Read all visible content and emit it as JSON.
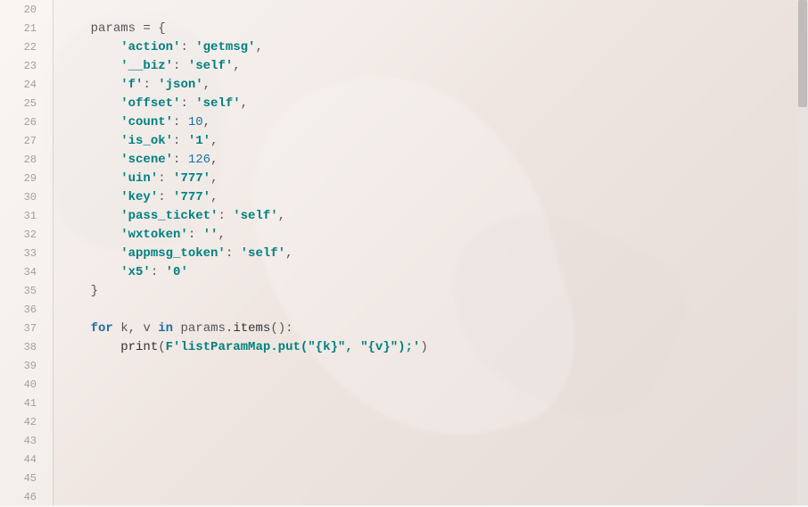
{
  "editor": {
    "lines": [
      {
        "num": 20,
        "indent": 0,
        "tokens": []
      },
      {
        "num": 21,
        "indent": 1,
        "tokens": [
          {
            "t": "id",
            "v": "params"
          },
          {
            "t": "punc",
            "v": " = {"
          }
        ]
      },
      {
        "num": 22,
        "indent": 2,
        "tokens": [
          {
            "t": "key",
            "v": "'action'"
          },
          {
            "t": "punc",
            "v": ": "
          },
          {
            "t": "str",
            "v": "'getmsg'"
          },
          {
            "t": "punc",
            "v": ","
          }
        ]
      },
      {
        "num": 23,
        "indent": 2,
        "tokens": [
          {
            "t": "key",
            "v": "'__biz'"
          },
          {
            "t": "punc",
            "v": ": "
          },
          {
            "t": "str",
            "v": "'self'"
          },
          {
            "t": "punc",
            "v": ","
          }
        ]
      },
      {
        "num": 24,
        "indent": 2,
        "tokens": [
          {
            "t": "key",
            "v": "'f'"
          },
          {
            "t": "punc",
            "v": ": "
          },
          {
            "t": "str",
            "v": "'json'"
          },
          {
            "t": "punc",
            "v": ","
          }
        ]
      },
      {
        "num": 25,
        "indent": 2,
        "tokens": [
          {
            "t": "key",
            "v": "'offset'"
          },
          {
            "t": "punc",
            "v": ": "
          },
          {
            "t": "str",
            "v": "'self'"
          },
          {
            "t": "punc",
            "v": ","
          }
        ]
      },
      {
        "num": 26,
        "indent": 2,
        "tokens": [
          {
            "t": "key",
            "v": "'count'"
          },
          {
            "t": "punc",
            "v": ": "
          },
          {
            "t": "num",
            "v": "10"
          },
          {
            "t": "punc",
            "v": ","
          }
        ]
      },
      {
        "num": 27,
        "indent": 2,
        "tokens": [
          {
            "t": "key",
            "v": "'is_ok'"
          },
          {
            "t": "punc",
            "v": ": "
          },
          {
            "t": "str",
            "v": "'1'"
          },
          {
            "t": "punc",
            "v": ","
          }
        ]
      },
      {
        "num": 28,
        "indent": 2,
        "tokens": [
          {
            "t": "key",
            "v": "'scene'"
          },
          {
            "t": "punc",
            "v": ": "
          },
          {
            "t": "num",
            "v": "126"
          },
          {
            "t": "punc",
            "v": ","
          }
        ]
      },
      {
        "num": 29,
        "indent": 2,
        "tokens": [
          {
            "t": "key",
            "v": "'uin'"
          },
          {
            "t": "punc",
            "v": ": "
          },
          {
            "t": "str",
            "v": "'777'"
          },
          {
            "t": "punc",
            "v": ","
          }
        ]
      },
      {
        "num": 30,
        "indent": 2,
        "tokens": [
          {
            "t": "key",
            "v": "'key'"
          },
          {
            "t": "punc",
            "v": ": "
          },
          {
            "t": "str",
            "v": "'777'"
          },
          {
            "t": "punc",
            "v": ","
          }
        ]
      },
      {
        "num": 31,
        "indent": 2,
        "tokens": [
          {
            "t": "key",
            "v": "'pass_ticket'"
          },
          {
            "t": "punc",
            "v": ": "
          },
          {
            "t": "str",
            "v": "'self'"
          },
          {
            "t": "punc",
            "v": ","
          }
        ]
      },
      {
        "num": 32,
        "indent": 2,
        "tokens": [
          {
            "t": "key",
            "v": "'wxtoken'"
          },
          {
            "t": "punc",
            "v": ": "
          },
          {
            "t": "str",
            "v": "''"
          },
          {
            "t": "punc",
            "v": ","
          }
        ]
      },
      {
        "num": 33,
        "indent": 2,
        "tokens": [
          {
            "t": "key",
            "v": "'appmsg_token'"
          },
          {
            "t": "punc",
            "v": ": "
          },
          {
            "t": "str",
            "v": "'self'"
          },
          {
            "t": "punc",
            "v": ","
          }
        ]
      },
      {
        "num": 34,
        "indent": 2,
        "tokens": [
          {
            "t": "key",
            "v": "'x5'"
          },
          {
            "t": "punc",
            "v": ": "
          },
          {
            "t": "str",
            "v": "'0'"
          }
        ]
      },
      {
        "num": 35,
        "indent": 1,
        "tokens": [
          {
            "t": "punc",
            "v": "}"
          }
        ]
      },
      {
        "num": 36,
        "indent": 0,
        "tokens": []
      },
      {
        "num": 37,
        "indent": 1,
        "tokens": [
          {
            "t": "kw",
            "v": "for"
          },
          {
            "t": "punc",
            "v": " "
          },
          {
            "t": "id",
            "v": "k"
          },
          {
            "t": "punc",
            "v": ", "
          },
          {
            "t": "id",
            "v": "v"
          },
          {
            "t": "punc",
            "v": " "
          },
          {
            "t": "kw",
            "v": "in"
          },
          {
            "t": "punc",
            "v": " "
          },
          {
            "t": "id",
            "v": "params"
          },
          {
            "t": "punc",
            "v": "."
          },
          {
            "t": "fn",
            "v": "items"
          },
          {
            "t": "punc",
            "v": "():"
          }
        ]
      },
      {
        "num": 38,
        "indent": 2,
        "tokens": [
          {
            "t": "fn",
            "v": "print"
          },
          {
            "t": "punc",
            "v": "("
          },
          {
            "t": "fstr",
            "v": "F'listParamMap.put(\""
          },
          {
            "t": "interp",
            "v": "{k}"
          },
          {
            "t": "fstr",
            "v": "\", \""
          },
          {
            "t": "interp",
            "v": "{v}"
          },
          {
            "t": "fstr",
            "v": "\");'"
          },
          {
            "t": "punc",
            "v": ")"
          }
        ]
      },
      {
        "num": 39,
        "indent": 0,
        "tokens": []
      },
      {
        "num": 40,
        "indent": 0,
        "tokens": []
      },
      {
        "num": 41,
        "indent": 0,
        "tokens": []
      },
      {
        "num": 42,
        "indent": 0,
        "tokens": []
      },
      {
        "num": 43,
        "indent": 0,
        "tokens": []
      },
      {
        "num": 44,
        "indent": 0,
        "tokens": []
      },
      {
        "num": 45,
        "indent": 0,
        "tokens": []
      },
      {
        "num": 46,
        "indent": 0,
        "tokens": []
      }
    ],
    "indent_unit": "    "
  }
}
